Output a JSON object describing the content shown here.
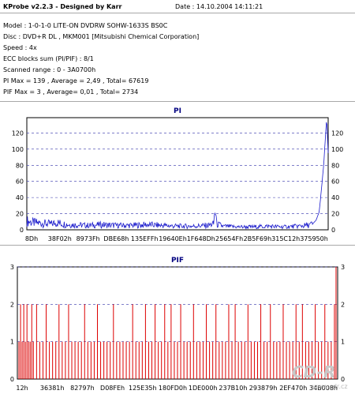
{
  "header": {
    "title": "KProbe v2.2.3 - Designed by Karr",
    "date": "Date : 14.10.2004 14:11:21",
    "lines": [
      "Model : 1-0-1-0 LITE-ON DVDRW SOHW-1633S BS0C",
      "Disc : DVD+R DL , MKM001 [Mitsubishi Chemical Corporation]",
      "Speed : 4x",
      "ECC blocks sum (PI/PIF) : 8/1",
      "Scanned range : 0 - 3A0700h",
      "PI Max = 139 , Average = 2,49 , Total= 67619",
      "PIF Max = 3 , Average= 0,01 , Total= 2734"
    ]
  },
  "watermark": "www.cdr.cz",
  "colors": {
    "pi_series": "#1a1acc",
    "pif_series": "#dd0000",
    "grid": "#3333aa",
    "title": "#000080"
  },
  "chart_data": [
    {
      "type": "area",
      "title": "PI",
      "ylim": [
        0,
        139
      ],
      "yticks": [
        0,
        20,
        40,
        60,
        80,
        100,
        120
      ],
      "grid": true,
      "xtick_labels": [
        "8Dh",
        "38F02h",
        "8973Fh",
        "DBE68h",
        "135EFFh",
        "19640Eh",
        "1F648Dh",
        "25654Fh",
        "2B5F69h",
        "315C12h",
        "375950h"
      ],
      "series": [
        {
          "x_fraction": [
            0.0,
            0.02,
            0.05,
            0.08,
            0.1,
            0.12,
            0.15,
            0.2,
            0.25,
            0.3,
            0.35,
            0.4,
            0.45,
            0.5,
            0.55,
            0.6,
            0.62,
            0.625,
            0.63,
            0.65,
            0.7,
            0.75,
            0.8,
            0.85,
            0.9,
            0.93,
            0.95,
            0.96,
            0.97,
            0.975,
            0.98,
            0.985,
            0.99,
            0.995,
            1.0
          ],
          "values": [
            12,
            10,
            9,
            8,
            10,
            8,
            7,
            6,
            7,
            6,
            6,
            7,
            6,
            5,
            5,
            6,
            8,
            30,
            8,
            5,
            4,
            4,
            5,
            4,
            5,
            6,
            8,
            12,
            22,
            40,
            60,
            80,
            110,
            139,
            95
          ]
        }
      ]
    },
    {
      "type": "bar",
      "title": "PIF",
      "ylim": [
        0,
        3
      ],
      "yticks": [
        0,
        1,
        2,
        3
      ],
      "grid": true,
      "xtick_labels": [
        "12h",
        "36381h",
        "82797h",
        "D08FEh",
        "125E35h",
        "180FD0h",
        "1DE000h",
        "237B10h",
        "293879h",
        "2EF470h",
        "34B008h"
      ],
      "series": [
        {
          "x_fraction": [
            0.005,
            0.01,
            0.015,
            0.02,
            0.025,
            0.03,
            0.035,
            0.04,
            0.045,
            0.05,
            0.06,
            0.07,
            0.08,
            0.09,
            0.1,
            0.11,
            0.12,
            0.13,
            0.14,
            0.15,
            0.16,
            0.17,
            0.18,
            0.19,
            0.2,
            0.21,
            0.22,
            0.23,
            0.24,
            0.25,
            0.26,
            0.27,
            0.28,
            0.29,
            0.3,
            0.31,
            0.32,
            0.33,
            0.34,
            0.35,
            0.36,
            0.37,
            0.38,
            0.39,
            0.4,
            0.41,
            0.42,
            0.43,
            0.44,
            0.45,
            0.46,
            0.47,
            0.48,
            0.49,
            0.5,
            0.51,
            0.52,
            0.53,
            0.54,
            0.55,
            0.56,
            0.57,
            0.58,
            0.59,
            0.6,
            0.61,
            0.62,
            0.63,
            0.64,
            0.65,
            0.66,
            0.67,
            0.68,
            0.69,
            0.7,
            0.71,
            0.72,
            0.73,
            0.74,
            0.75,
            0.76,
            0.77,
            0.78,
            0.79,
            0.8,
            0.81,
            0.82,
            0.83,
            0.84,
            0.85,
            0.86,
            0.87,
            0.88,
            0.89,
            0.9,
            0.91,
            0.92,
            0.93,
            0.94,
            0.95,
            0.96,
            0.97,
            0.98,
            0.99,
            0.995
          ],
          "values": [
            1,
            2,
            1,
            2,
            1,
            2,
            1,
            1,
            2,
            1,
            2,
            1,
            1,
            2,
            1,
            1,
            1,
            2,
            1,
            1,
            2,
            1,
            1,
            1,
            1,
            2,
            1,
            1,
            1,
            2,
            1,
            1,
            1,
            1,
            2,
            1,
            1,
            1,
            1,
            1,
            2,
            1,
            1,
            1,
            2,
            1,
            1,
            2,
            1,
            1,
            2,
            1,
            2,
            1,
            1,
            2,
            1,
            1,
            1,
            2,
            1,
            1,
            1,
            2,
            1,
            1,
            2,
            1,
            1,
            1,
            2,
            1,
            2,
            1,
            1,
            1,
            2,
            1,
            1,
            1,
            2,
            1,
            1,
            2,
            1,
            1,
            1,
            2,
            1,
            1,
            1,
            2,
            1,
            2,
            1,
            1,
            1,
            2,
            1,
            1,
            2,
            1,
            1,
            2,
            3
          ]
        }
      ]
    }
  ]
}
